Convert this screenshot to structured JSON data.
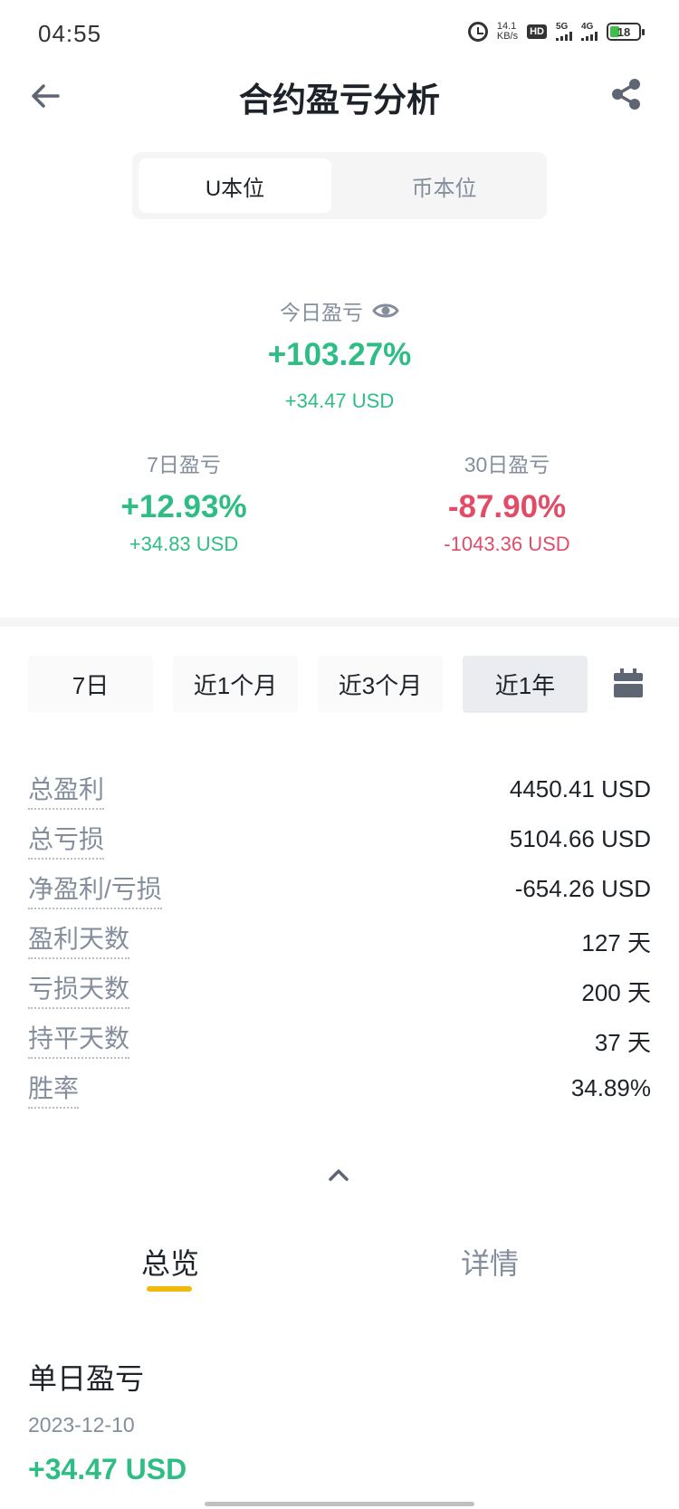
{
  "status_bar": {
    "time": "04:55",
    "net_speed_value": "14.1",
    "net_speed_unit": "KB/s",
    "hd_label": "HD",
    "signal1_label": "5G",
    "signal2_label": "4G",
    "battery_level": "18",
    "battery_color": "#3fbf4a"
  },
  "header": {
    "title": "合约盈亏分析",
    "back_icon": "arrow-left-icon",
    "share_icon": "share-icon"
  },
  "segmented": {
    "options": [
      "U本位",
      "币本位"
    ],
    "selected": "U本位"
  },
  "today": {
    "label": "今日盈亏",
    "percent": "+103.27%",
    "usd": "+34.47 USD",
    "icon": "eye-icon"
  },
  "seven_day": {
    "label": "7日盈亏",
    "percent": "+12.93%",
    "usd": "+34.83 USD"
  },
  "thirty_day": {
    "label": "30日盈亏",
    "percent": "-87.90%",
    "usd": "-1043.36 USD"
  },
  "ranges": {
    "options": [
      "7日",
      "近1个月",
      "近3个月",
      "近1年"
    ],
    "selected": "近1年",
    "calendar_icon": "calendar-icon"
  },
  "stats": [
    {
      "label": "总盈利",
      "value": "4450.41 USD"
    },
    {
      "label": "总亏损",
      "value": "5104.66 USD"
    },
    {
      "label": "净盈利/亏损",
      "value": "-654.26 USD"
    },
    {
      "label": "盈利天数",
      "value": "127 天"
    },
    {
      "label": "亏损天数",
      "value": "200 天"
    },
    {
      "label": "持平天数",
      "value": "37 天"
    },
    {
      "label": "胜率",
      "value": "34.89%"
    }
  ],
  "tabs": {
    "items": [
      "总览",
      "详情"
    ],
    "selected": "总览"
  },
  "daily": {
    "title": "单日盈亏",
    "date": "2023-12-10",
    "value": "+34.47 USD"
  },
  "colors": {
    "profit": "#2ebd85",
    "loss": "#e24c66",
    "accent": "#f0b90b",
    "muted": "#848e9c"
  }
}
